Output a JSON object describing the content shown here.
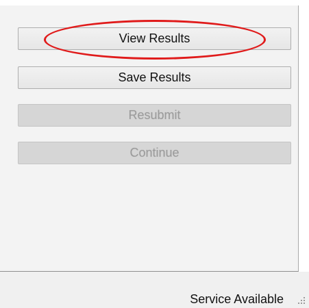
{
  "buttons": {
    "view_results": "View Results",
    "save_results": "Save Results",
    "resubmit": "Resubmit",
    "continue": "Continue"
  },
  "status_bar": {
    "text": "Service Available"
  },
  "icons": {
    "resize_grip": "resize-grip-icon"
  },
  "colors": {
    "highlight": "#e01b1b",
    "button_face": "#e6e6e6",
    "disabled_face": "#d6d6d6",
    "panel_bg": "#f3f3f3"
  }
}
